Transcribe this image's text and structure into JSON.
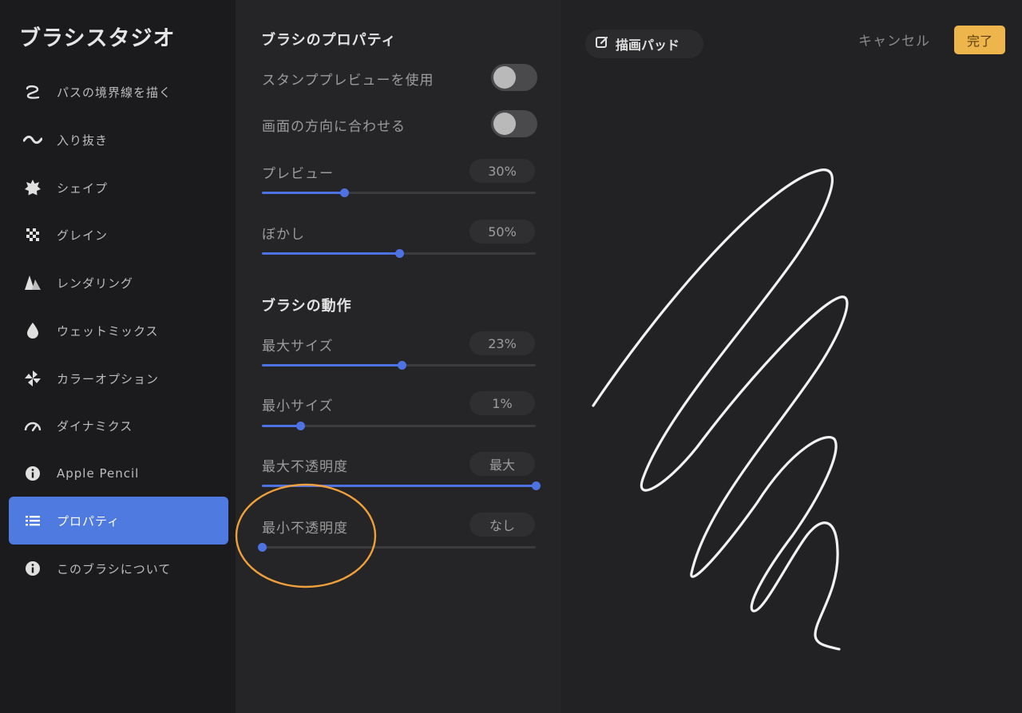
{
  "app": {
    "title": "ブラシスタジオ"
  },
  "sidebar": {
    "items": [
      {
        "label": "パスの境界線を描く",
        "icon": "path-stroke-icon"
      },
      {
        "label": "入り抜き",
        "icon": "taper-wave-icon"
      },
      {
        "label": "シェイプ",
        "icon": "shape-icon"
      },
      {
        "label": "グレイン",
        "icon": "grain-icon"
      },
      {
        "label": "レンダリング",
        "icon": "rendering-icon"
      },
      {
        "label": "ウェットミックス",
        "icon": "wet-drop-icon"
      },
      {
        "label": "カラーオプション",
        "icon": "color-options-icon"
      },
      {
        "label": "ダイナミクス",
        "icon": "dynamics-gauge-icon"
      },
      {
        "label": "Apple Pencil",
        "icon": "info-icon"
      },
      {
        "label": "プロパティ",
        "icon": "list-icon",
        "active": true
      },
      {
        "label": "このブラシについて",
        "icon": "info-icon"
      }
    ]
  },
  "properties": {
    "brush_props_title": "ブラシのプロパティ",
    "stamp_preview": {
      "label": "スタンププレビューを使用",
      "on": false
    },
    "orient_screen": {
      "label": "画面の方向に合わせる",
      "on": false
    },
    "preview": {
      "label": "プレビュー",
      "value": "30%",
      "level": 0.3
    },
    "blur": {
      "label": "ぼかし",
      "value": "50%",
      "level": 0.5
    },
    "behavior_title": "ブラシの動作",
    "max_size": {
      "label": "最大サイズ",
      "value": "23%",
      "level": 0.51
    },
    "min_size": {
      "label": "最小サイズ",
      "value": "1%",
      "level": 0.14
    },
    "max_opacity": {
      "label": "最大不透明度",
      "value": "最大",
      "level": 1.0
    },
    "min_opacity": {
      "label": "最小不透明度",
      "value": "なし",
      "level": 0.0
    }
  },
  "pad": {
    "tab_label": "描画パッド",
    "cancel_label": "キャンセル",
    "done_label": "完了"
  },
  "colors": {
    "accent": "#4f72e2",
    "done": "#eeb54c",
    "highlight": "#f0a03a"
  }
}
